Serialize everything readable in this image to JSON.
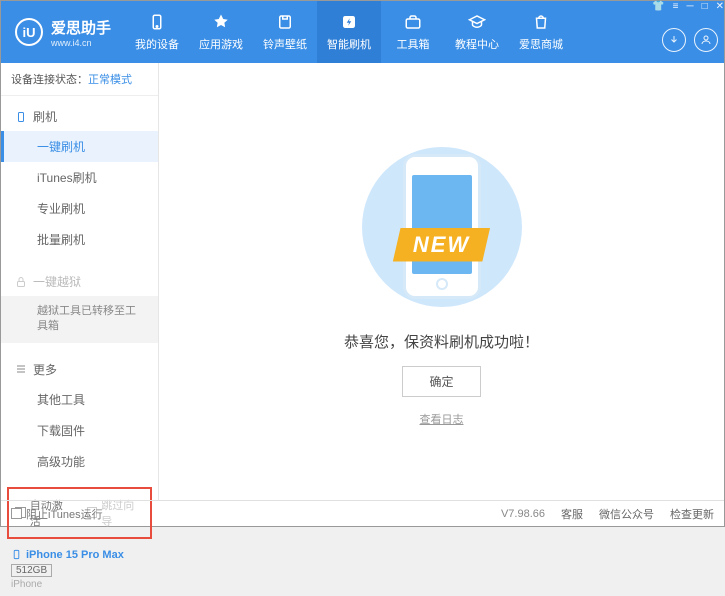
{
  "header": {
    "logo_letter": "iU",
    "app_name": "爱思助手",
    "app_url": "www.i4.cn",
    "nav": [
      {
        "label": "我的设备",
        "icon": "device"
      },
      {
        "label": "应用游戏",
        "icon": "apps"
      },
      {
        "label": "铃声壁纸",
        "icon": "ringtone"
      },
      {
        "label": "智能刷机",
        "icon": "flash"
      },
      {
        "label": "工具箱",
        "icon": "toolbox"
      },
      {
        "label": "教程中心",
        "icon": "tutorial"
      },
      {
        "label": "爱思商城",
        "icon": "store"
      }
    ],
    "active_nav_index": 3
  },
  "sidebar": {
    "conn_label": "设备连接状态：",
    "conn_mode": "正常模式",
    "section_flash": {
      "title": "刷机",
      "items": [
        "一键刷机",
        "iTunes刷机",
        "专业刷机",
        "批量刷机"
      ],
      "active_index": 0
    },
    "section_jailbreak": {
      "title": "一键越狱",
      "sub_text": "越狱工具已转移至工具箱"
    },
    "section_more": {
      "title": "更多",
      "items": [
        "其他工具",
        "下载固件",
        "高级功能"
      ]
    },
    "checkboxes": {
      "auto_activate": "自动激活",
      "skip_wizard": "跳过向导"
    },
    "device": {
      "name": "iPhone 15 Pro Max",
      "storage": "512GB",
      "type": "iPhone"
    }
  },
  "main": {
    "ribbon_text": "NEW",
    "success_msg": "恭喜您，保资料刷机成功啦！",
    "ok_button": "确定",
    "log_link": "查看日志"
  },
  "footer": {
    "block_itunes": "阻止iTunes运行",
    "version": "V7.98.66",
    "links": [
      "客服",
      "微信公众号",
      "检查更新"
    ]
  }
}
